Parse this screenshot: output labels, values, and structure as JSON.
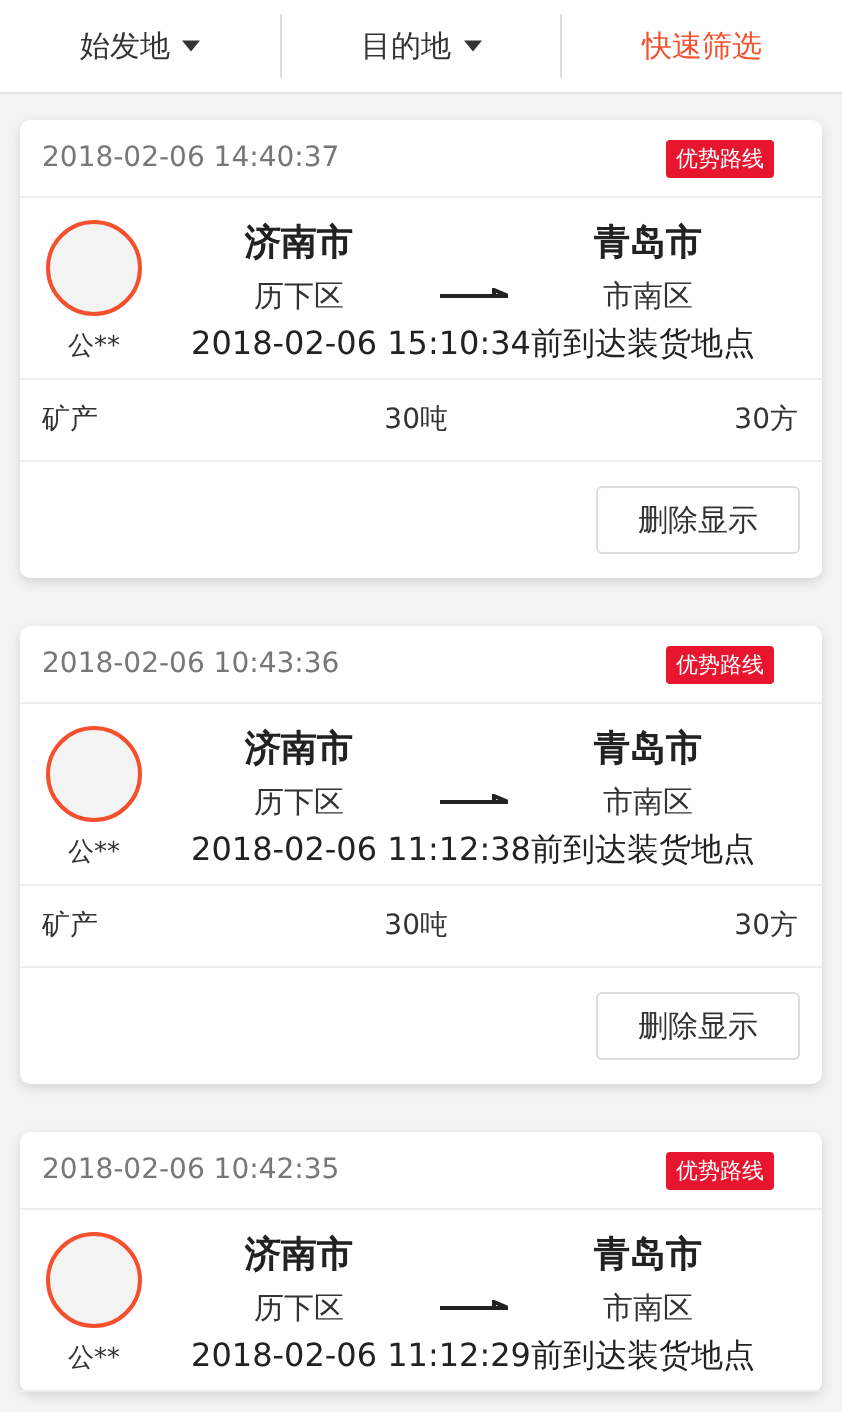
{
  "filters": [
    {
      "label": "始发地",
      "kind": "dropdown"
    },
    {
      "label": "目的地",
      "kind": "dropdown"
    },
    {
      "label": "快速筛选",
      "kind": "action"
    }
  ],
  "orders": [
    {
      "time": "2018-02-06 14:40:37",
      "badge": "优势路线",
      "shipper": "公**",
      "origin": {
        "city": "济南市",
        "district": "历下区"
      },
      "destination": {
        "city": "青岛市",
        "district": "市南区"
      },
      "deadline": "2018-02-06 15:10:34前到达装货地点",
      "goods": {
        "type": "矿产",
        "weight": "30吨",
        "volume": "30方"
      },
      "button": "删除显示"
    },
    {
      "time": "2018-02-06 10:43:36",
      "badge": "优势路线",
      "shipper": "公**",
      "origin": {
        "city": "济南市",
        "district": "历下区"
      },
      "destination": {
        "city": "青岛市",
        "district": "市南区"
      },
      "deadline": "2018-02-06 11:12:38前到达装货地点",
      "goods": {
        "type": "矿产",
        "weight": "30吨",
        "volume": "30方"
      },
      "button": "删除显示"
    },
    {
      "time": "2018-02-06 10:42:35",
      "badge": "优势路线",
      "shipper": "公**",
      "origin": {
        "city": "济南市",
        "district": "历下区"
      },
      "destination": {
        "city": "青岛市",
        "district": "市南区"
      },
      "deadline": "2018-02-06 11:12:29前到达装货地点"
    }
  ]
}
